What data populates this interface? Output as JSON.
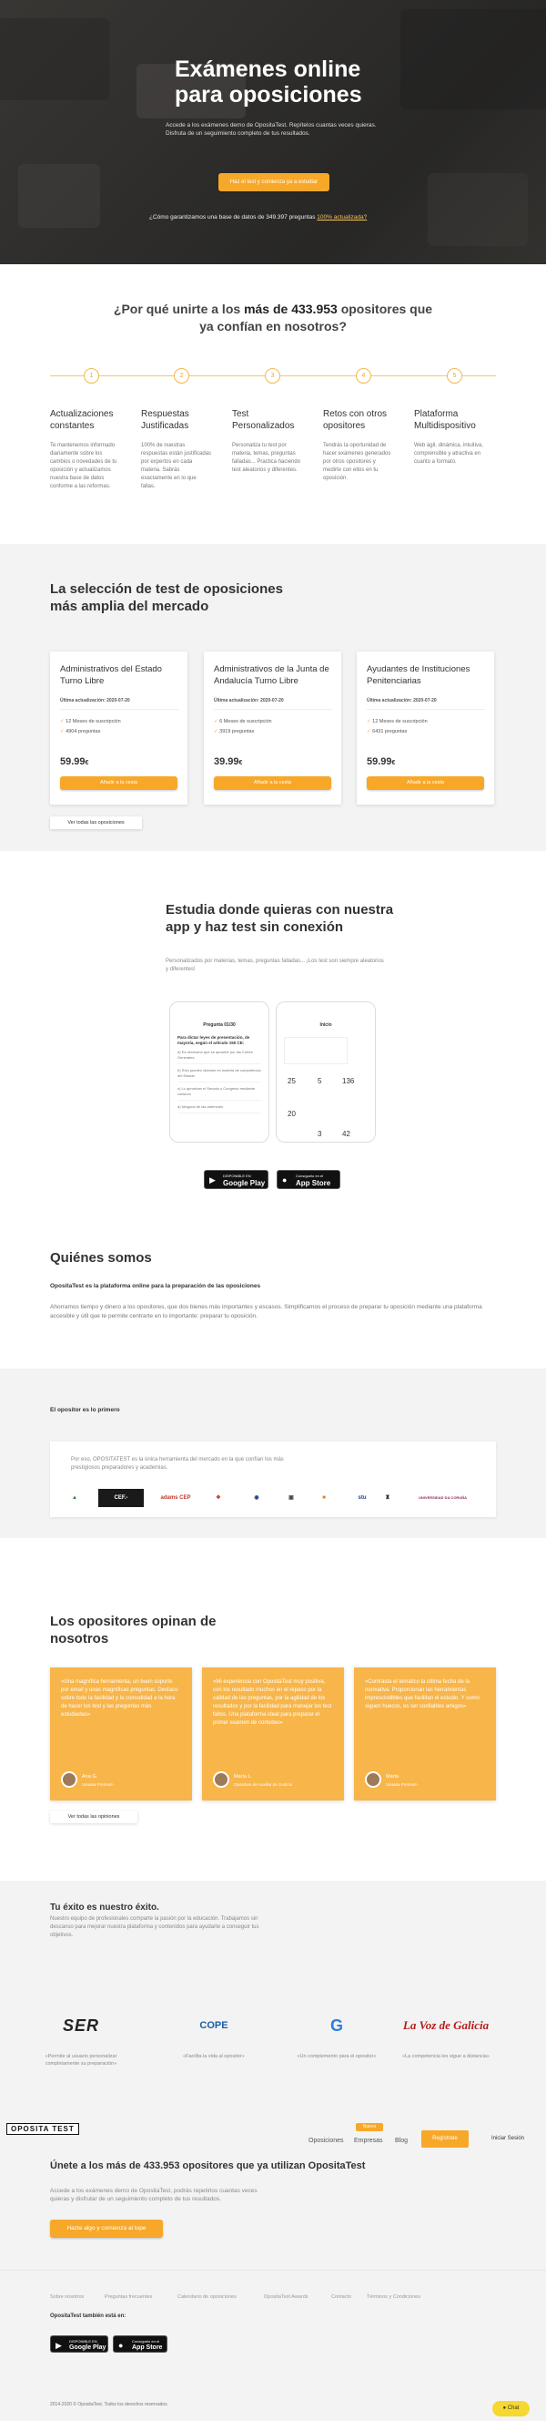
{
  "hero": {
    "title": "Exámenes online para oposiciones",
    "subtitle": "Accede a los exámenes demo de OpositaTest. Repítelos cuantas veces quieras. Disfruta de un seguimiento completo de tus resultados.",
    "cta": "Haz el test y comienza ya a estudiar",
    "note_prefix": "¿Cómo garantizamos una base de datos de 349.397 preguntas",
    "note_link": "100% actualizada?"
  },
  "why": {
    "title_pre": "¿Por qué unirte a los",
    "title_bold": "más de 433.953",
    "title_post": "opositores que ya confían en nosotros?",
    "features": [
      {
        "n": "1",
        "title": "Actualizaciones constantes",
        "desc": "Te mantenemos informado diariamente sobre los cambios o novedades de tu oposición y actualizamos nuestra base de datos conforme a las reformas."
      },
      {
        "n": "2",
        "title": "Respuestas Justificadas",
        "desc": "100% de nuestras respuestas están justificadas por expertos en cada materia. Sabrás exactamente en lo que fallas."
      },
      {
        "n": "3",
        "title": "Test Personalizados",
        "desc": "Personaliza tu test por materia, temas, preguntas falladas... Practica haciendo test aleatorios y diferentes."
      },
      {
        "n": "4",
        "title": "Retos con otros opositores",
        "desc": "Tendrás la oportunidad de hacer exámenes generados por otros opositores y medirte con ellos en tu oposición."
      },
      {
        "n": "5",
        "title": "Plataforma Multidispositivo",
        "desc": "Web ágil, dinámica, intuitiva, comprensible y atractiva en cuanto a formato."
      }
    ]
  },
  "selection": {
    "title_pre": "La selección de",
    "title_bold": "test de oposiciones",
    "title_post": "más amplia del mercado",
    "cards": [
      {
        "title": "Administrativos del Estado Turno Libre",
        "updated": "Última actualización: 2020-07-20",
        "f1": "12 Meses de suscripción",
        "f2": "4904 preguntas",
        "price": "59.99",
        "cur": "€",
        "btn": "Añadir a la cesta"
      },
      {
        "title": "Administrativos de la Junta de Andalucía Turno Libre",
        "updated": "Última actualización: 2020-07-20",
        "f1": "6 Meses de suscripción",
        "f2": "3919 preguntas",
        "price": "39.99",
        "cur": "€",
        "btn": "Añadir a la cesta"
      },
      {
        "title": "Ayudantes de Instituciones Penitenciarias",
        "updated": "Última actualización: 2020-07-20",
        "f1": "12 Meses de suscripción",
        "f2": "6431 preguntas",
        "price": "59.99",
        "cur": "€",
        "btn": "Añadir a la cesta"
      }
    ],
    "all": "Ver todas las oposiciones"
  },
  "app": {
    "title_pre": "Estudia donde quieras con nuestra",
    "title_bold": "app y haz test sin conexión",
    "subtitle": "Personalizados por materias, temas, preguntas falladas... ¡Los test son siempre aleatorios y diferentes!",
    "phone1_header": "Pregunta 01/30",
    "phone1_q": "Para dictar leyes de presentación, de mayoría, según el artículo 150 CE:",
    "phone1_opts": [
      "a) Es necesario que se apruebe por las Cortes Generales",
      "b) Sólo pueden dictarse en materia de competencia del Estado",
      "c) Lo aprueban el Senado y Congreso mediante votación",
      "d) Ninguna de las anteriores"
    ],
    "phone2_header": "Inicio",
    "stats": [
      "25",
      "5",
      "136",
      "20",
      "3",
      "42"
    ],
    "gplay_small": "DISPONIBLE EN",
    "gplay": "Google Play",
    "astore_small": "Consíguelo en el",
    "astore": "App Store"
  },
  "who": {
    "title": "Quiénes somos",
    "bold": "OpositaTest es la plataforma online para la preparación de las oposiciones",
    "desc": "Ahorramos tiempo y dinero a los opositores, que dos bienes más importantes y escasos. Simplificamos el proceso de preparar tu oposición mediante una plataforma accesible y útil que te permite centrarte en lo importante: preparar tu oposición."
  },
  "first": {
    "title": "El opositor es lo primero",
    "desc": "Por eso, OPOSITATEST es la única herramienta del mercado en la que confían los más prestigiosos preparadores y academias.",
    "logos": [
      "▲",
      "CEF.-",
      "adams CEP",
      "❖",
      "◉",
      "▣",
      "■",
      "stu",
      "♜",
      "UNIVERSIDAD DA CORUÑA"
    ]
  },
  "opinions": {
    "title_pre": "Los opositores",
    "title_bold": "opinan de nosotros",
    "items": [
      {
        "quote": "«Una magnífica herramienta, un buen soporte por email y unas magníficas preguntas. Destaco sobre todo la facilidad y la comodidad a la hora de hacer los test y las preguntas más estudiadas»",
        "name": "Ana G.",
        "role": "Usuaria Premium"
      },
      {
        "quote": "«Mi experiencia con OpositaTest muy positiva, con los resultado muchos en el repaso por la calidad de las preguntas, por la agilidad de los resultados y por la facilidad para manejar los test fallos. Una plataforma ideal para preparar el primer examen de cortodeo»",
        "name": "María L.",
        "role": "Opositora de Auxiliar de Justicia"
      },
      {
        "quote": "«Contrasta el temático la última fecha de la normativa. Proporcionan las herramientas imprescindibles que facilitan el estudio. Y como siguen huecos, es ser confiables amigos»",
        "name": "Marta",
        "role": "Usuaria Premium"
      }
    ],
    "all": "Ver todas las opiniones"
  },
  "success": {
    "title": "Tu éxito es nuestro éxito.",
    "desc": "Nuestro equipo de profesionales comparte la pasión por la educación. Trabajamos sin descanso para mejorar nuestra plataforma y contenidos para ayudarte a conseguir tus objetivos.",
    "media": [
      {
        "logo": "SER",
        "caption": "«Permite al usuario personalizar completamente su preparación»"
      },
      {
        "logo": "COPE",
        "caption": "«Facilita la vida al opositor»"
      },
      {
        "logo": "G",
        "caption": "«Un complemento para el opositor»"
      },
      {
        "logo": "La Voz de Galicia",
        "caption": "«La competencia les sigue a distancia»"
      }
    ]
  },
  "header": {
    "brand": "OPOSITA TEST",
    "nav": [
      "Oposiciones",
      "Empresas",
      "Blog"
    ],
    "badge": "Nuevo",
    "register": "Regístrate",
    "login": "Iniciar Sesión"
  },
  "cta": {
    "title_pre": "Únete a los",
    "title_bold": "más de 433.953 opositores",
    "title_post": "que ya utilizan OpositaTest",
    "desc": "Accede a los exámenes demo de OpositaTest, podrás repetirlos cuantas veces quieras y disfrutar de un seguimiento completo de tus resultados.",
    "btn": "Hazte algo y comienza al tope"
  },
  "footer": {
    "links": [
      "Sobre nosotros",
      "Preguntas frecuentes",
      "Calendario de oposiciones",
      "OpositaTest Awards",
      "Contacto",
      "Términos y Condiciones"
    ],
    "also": "OpositaTest también está en:",
    "copyright": "2014-2020 © OpositaTest. Todos los derechos reservados.",
    "chat": "Chat"
  },
  "colors": {
    "accent": "#f7a829",
    "card": "#f7b54a"
  }
}
